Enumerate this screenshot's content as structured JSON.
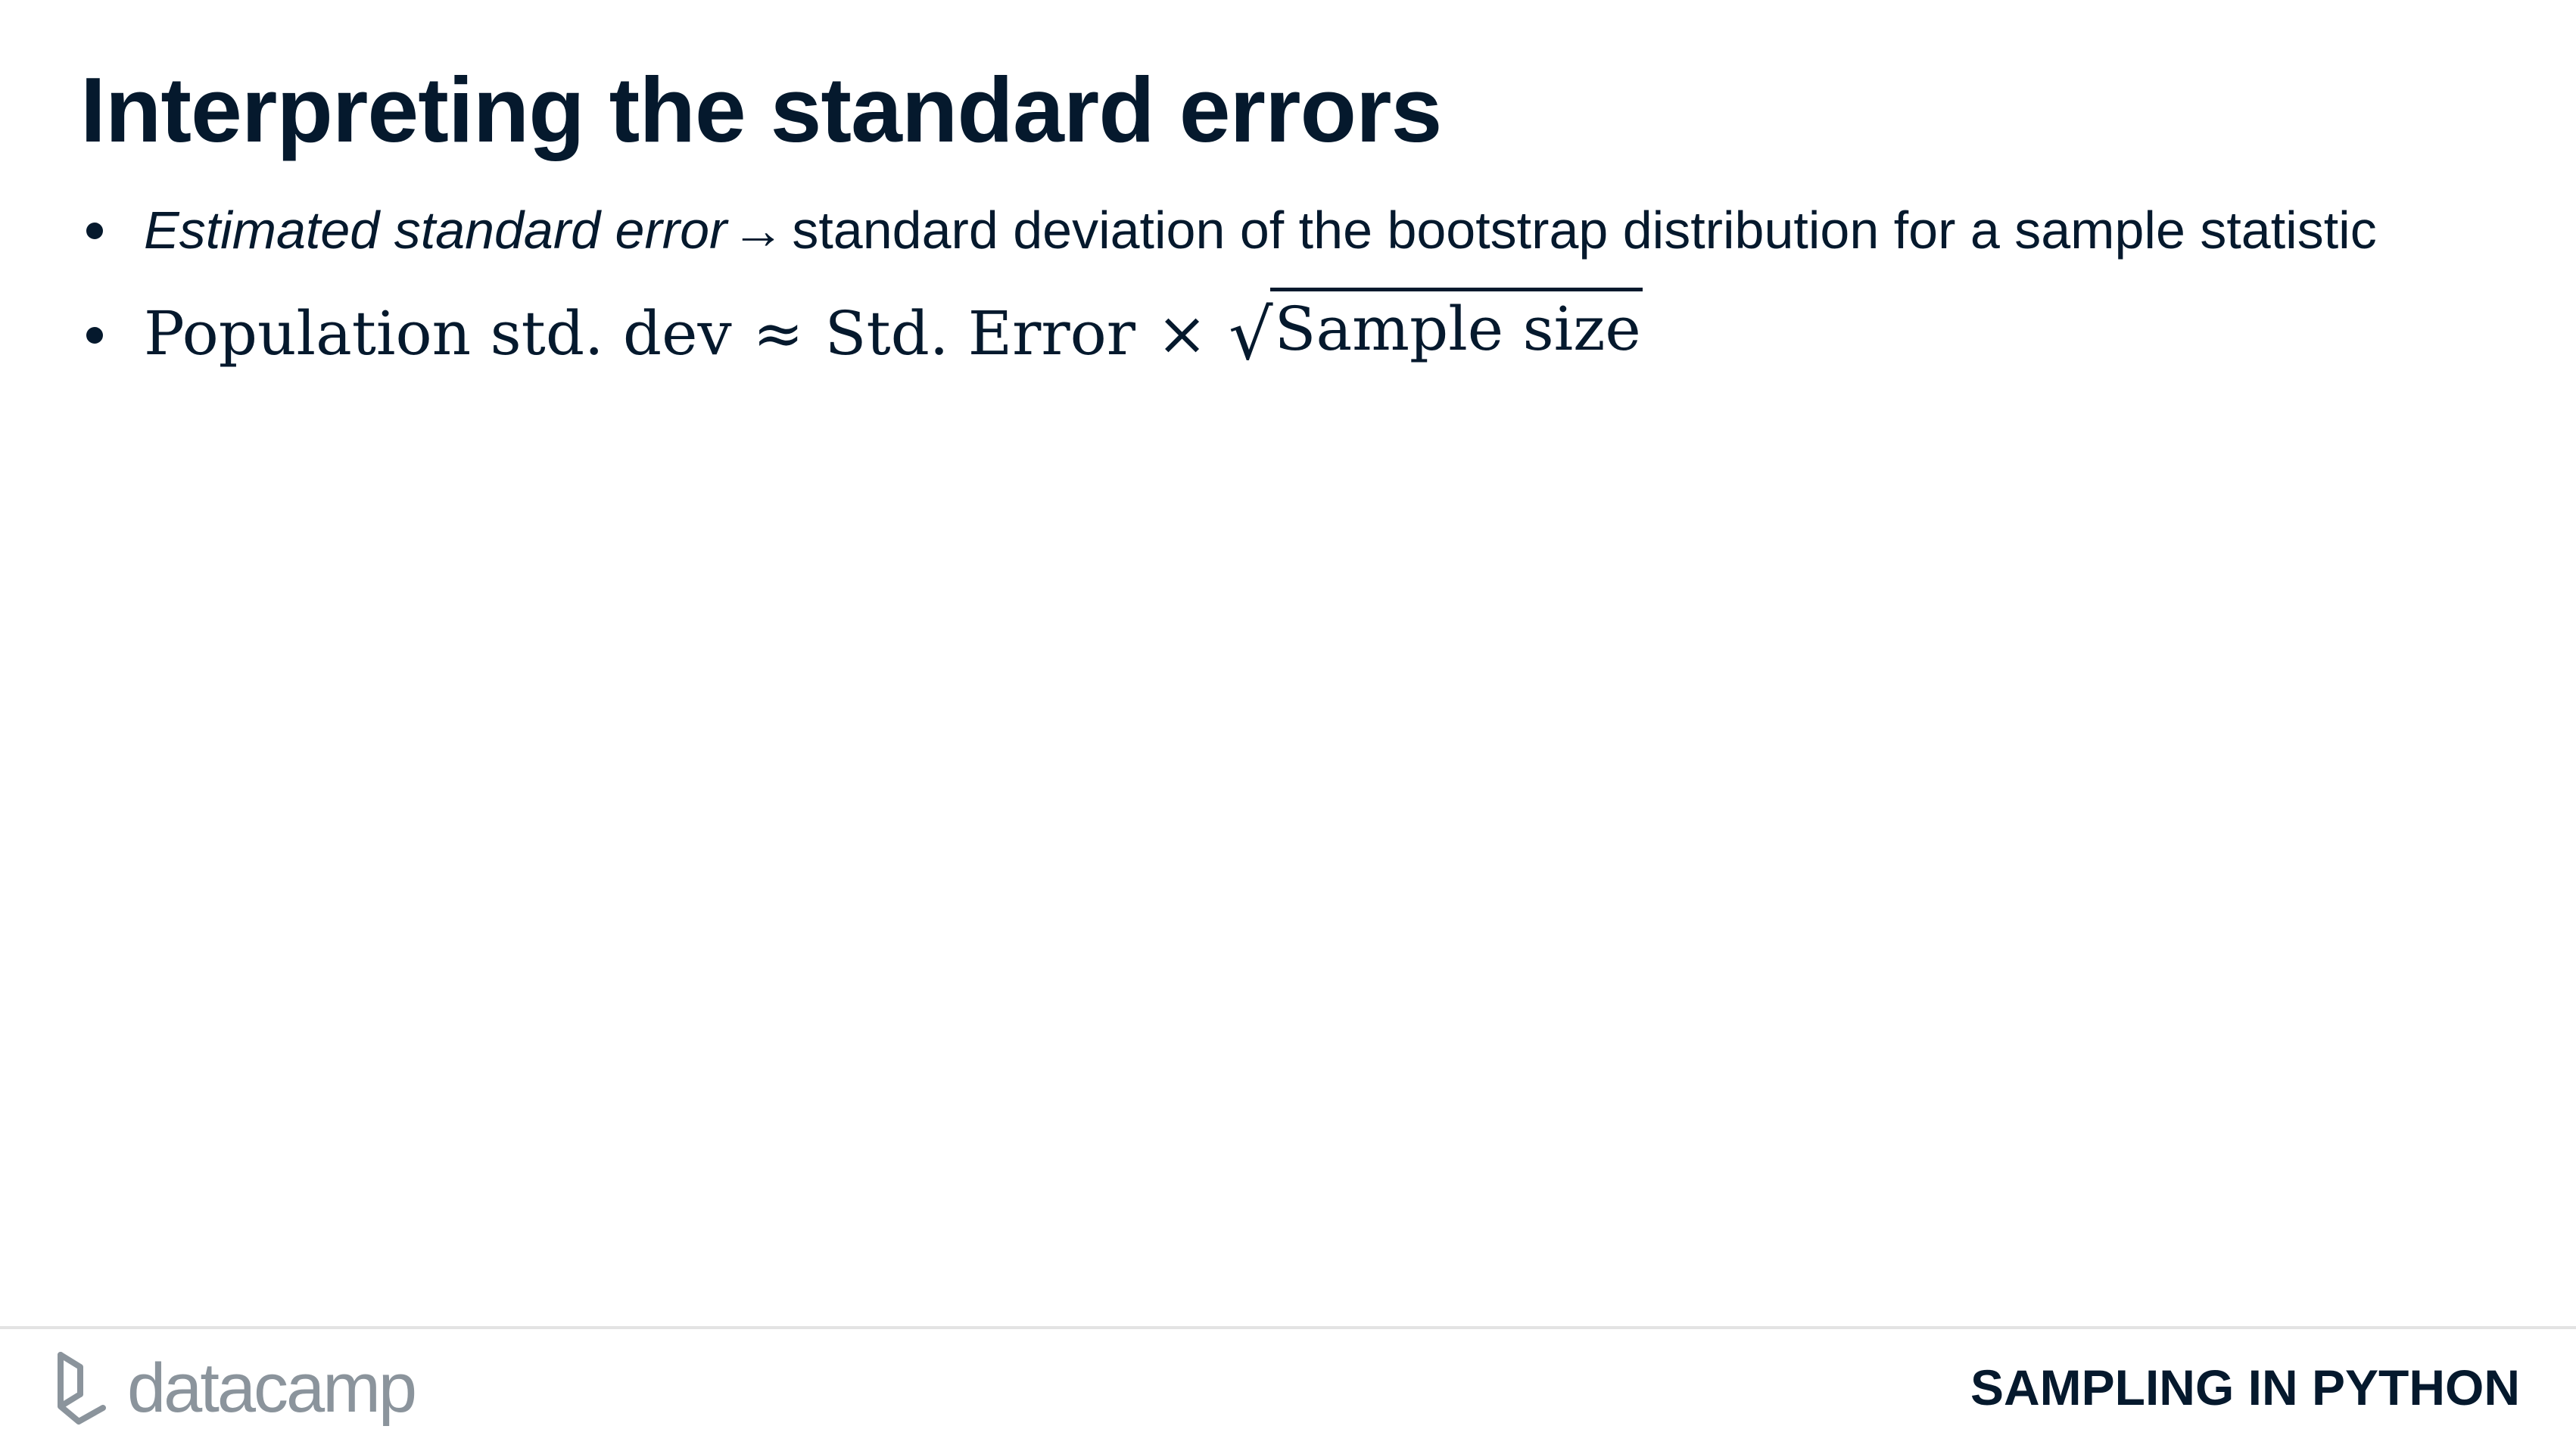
{
  "slide": {
    "title": "Interpreting the standard errors",
    "bullets": [
      {
        "term": "Estimated standard error",
        "arrow": "→",
        "text": "standard deviation of the bootstrap distribution for a sample statistic"
      },
      {
        "lhs": "Population std. dev",
        "approx": "≈",
        "middle": "Std. Error",
        "times": "×",
        "radical": "√",
        "radicand": "Sample size"
      }
    ]
  },
  "footer": {
    "logo_text": "datacamp",
    "course_title": "SAMPLING IN PYTHON",
    "rule_color": "#e3e3e3"
  },
  "colors": {
    "text": "#05192d",
    "logo": "#8b949c",
    "background": "#ffffff"
  },
  "icons": {
    "logo_mark": "datacamp-logo-icon"
  }
}
